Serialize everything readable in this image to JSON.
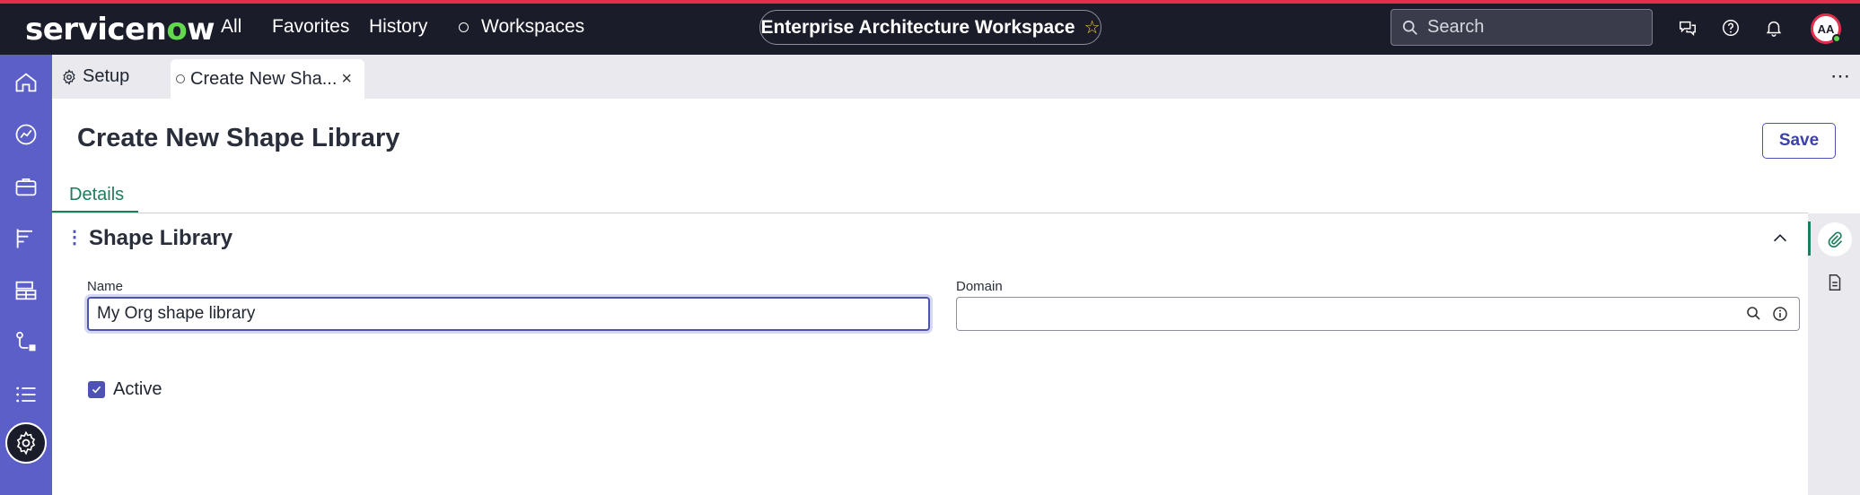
{
  "header": {
    "logo_text_a": "servicen",
    "logo_text_o": "o",
    "logo_text_b": "w",
    "nav": [
      "All",
      "Favorites",
      "History",
      "Workspaces"
    ],
    "workspace_pill": "Enterprise Architecture Workspace",
    "search_placeholder": "Search",
    "avatar_initials": "AA",
    "icons": [
      "chat-icon",
      "help-icon",
      "bell-icon"
    ]
  },
  "tabs": {
    "setup_label": "Setup",
    "create_label": "Create New Sha...",
    "more": "⋯"
  },
  "page": {
    "title": "Create New Shape Library",
    "save_label": "Save",
    "details_tab": "Details"
  },
  "section": {
    "title": "Shape Library",
    "name_label": "Name",
    "name_value": "My Org shape library",
    "domain_label": "Domain",
    "domain_value": "",
    "active_label": "Active",
    "active_checked": true
  },
  "colors": {
    "topbar": "#1b1c2a",
    "accent_red": "#e0304e",
    "brand_green": "#62d84e",
    "rail_purple": "#5b5fc7",
    "primary": "#4e53b3",
    "tab_green": "#1a7f5a"
  }
}
